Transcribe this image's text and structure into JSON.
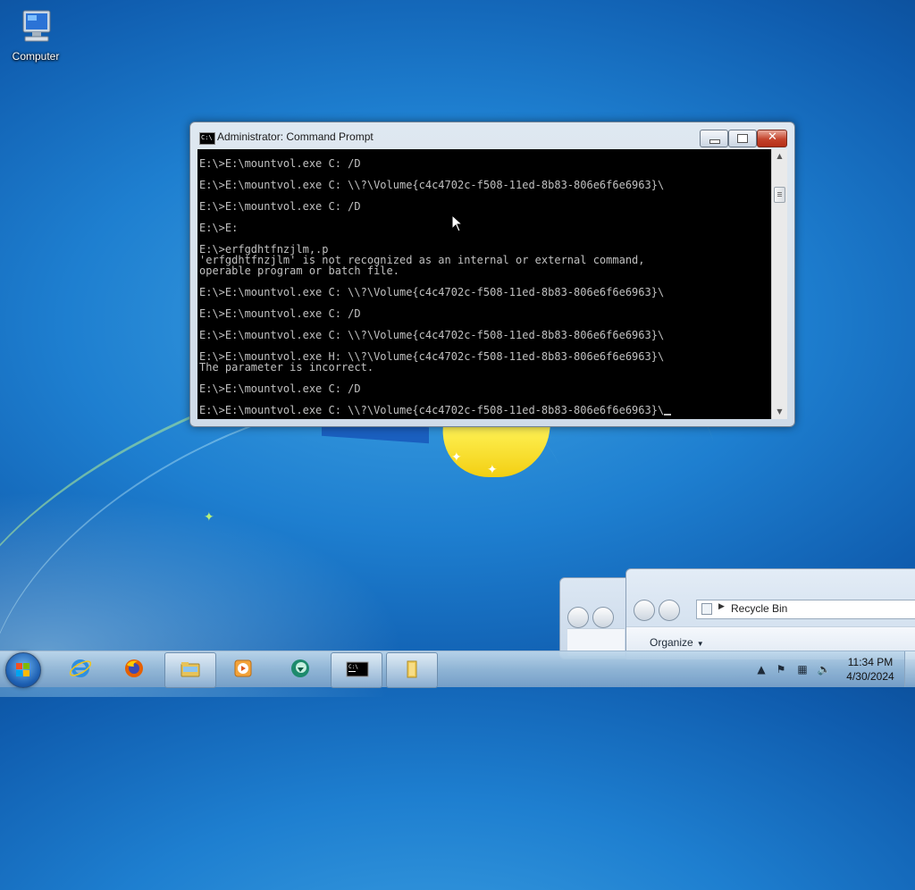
{
  "desktop": {
    "icons": [
      {
        "label": "Computer",
        "icon": "computer-icon"
      }
    ]
  },
  "cmd_window": {
    "title": "Administrator:  Command Prompt",
    "icon_text": "C:\\",
    "lines": [
      "E:\\>E:\\mountvol.exe C: /D",
      "",
      "E:\\>E:\\mountvol.exe C: \\\\?\\Volume{c4c4702c-f508-11ed-8b83-806e6f6e6963}\\",
      "",
      "E:\\>E:\\mountvol.exe C: /D",
      "",
      "E:\\>E:",
      "",
      "E:\\>erfgdhtfnzjlm,.p",
      "'erfgdhtfnzjlm' is not recognized as an internal or external command,",
      "operable program or batch file.",
      "",
      "E:\\>E:\\mountvol.exe C: \\\\?\\Volume{c4c4702c-f508-11ed-8b83-806e6f6e6963}\\",
      "",
      "E:\\>E:\\mountvol.exe C: /D",
      "",
      "E:\\>E:\\mountvol.exe C: \\\\?\\Volume{c4c4702c-f508-11ed-8b83-806e6f6e6963}\\",
      "",
      "E:\\>E:\\mountvol.exe H: \\\\?\\Volume{c4c4702c-f508-11ed-8b83-806e6f6e6963}\\",
      "The parameter is incorrect.",
      "",
      "E:\\>E:\\mountvol.exe C: /D",
      "",
      "E:\\>E:\\mountvol.exe C: \\\\?\\Volume{c4c4702c-f508-11ed-8b83-806e6f6e6963}\\"
    ]
  },
  "explorer": {
    "address": "Recycle Bin",
    "organize_label": "Organize"
  },
  "taskbar": {
    "items": [
      {
        "name": "internet-explorer",
        "active": false
      },
      {
        "name": "firefox",
        "active": false
      },
      {
        "name": "windows-explorer",
        "active": true
      },
      {
        "name": "media-player",
        "active": false
      },
      {
        "name": "app-circle",
        "active": false
      },
      {
        "name": "command-prompt",
        "active": true
      },
      {
        "name": "folder",
        "active": true
      }
    ],
    "clock_time": "11:34 PM",
    "clock_date": "4/30/2024"
  },
  "colors": {
    "console_bg": "#000000",
    "console_fg": "#c0c0c0",
    "close_button": "#c4432b"
  }
}
